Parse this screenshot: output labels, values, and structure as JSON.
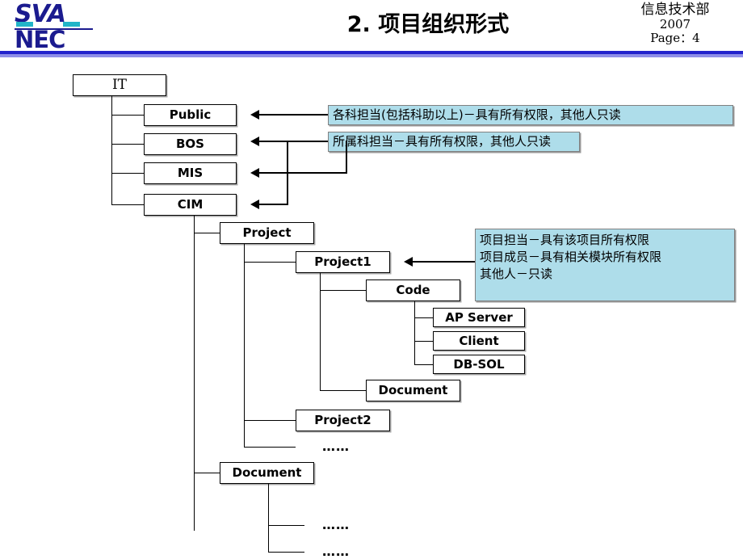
{
  "header": {
    "logo_sva": "SVA",
    "logo_nec": "NEC",
    "title": "2. 项目组织形式",
    "department": "信息技术部",
    "year": "2007",
    "page_label": "Page：4"
  },
  "colors": {
    "brand_blue": "#1b1b8f",
    "brand_cyan": "#22b5c8",
    "rule_blue": "#2222cc",
    "rule_light": "#8e8ee8",
    "callout_bg": "#aeddea",
    "callout_border": "#808080",
    "node_border": "#000000"
  },
  "tree": {
    "root": "IT",
    "dept_nodes": [
      "Public",
      "BOS",
      "MIS",
      "CIM"
    ],
    "project_node": "Project",
    "project1": "Project1",
    "code": "Code",
    "code_children": [
      "AP Server",
      "Client",
      "DB-SOL"
    ],
    "project1_document": "Document",
    "project2": "Project2",
    "project_ellipsis": "……",
    "document_node": "Document",
    "document_children": [
      "……",
      "……"
    ]
  },
  "callouts": [
    {
      "id": "callout-public",
      "lines": [
        "各科担当(包括科助以上)－具有所有权限，其他人只读"
      ],
      "target": "Public"
    },
    {
      "id": "callout-bos-mis-cim",
      "lines": [
        "所属科担当－具有所有权限，其他人只读"
      ],
      "target": "BOS / MIS / CIM"
    },
    {
      "id": "callout-project1",
      "lines": [
        "项目担当－具有该项目所有权限",
        "项目成员－具有相关模块所有权限",
        "其他人－只读"
      ],
      "target": "Project1"
    }
  ]
}
